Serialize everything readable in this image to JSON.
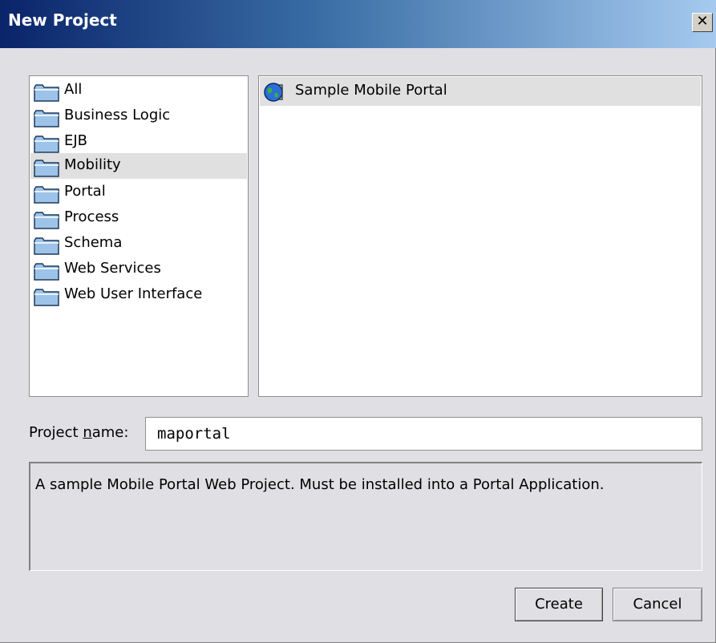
{
  "window": {
    "title": "New Project",
    "close_glyph": "✕"
  },
  "categories": {
    "items": [
      {
        "label": "All",
        "icon": "folder-icon"
      },
      {
        "label": "Business Logic",
        "icon": "folder-icon"
      },
      {
        "label": "EJB",
        "icon": "folder-icon"
      },
      {
        "label": "Mobility",
        "icon": "folder-icon",
        "selected": true
      },
      {
        "label": "Portal",
        "icon": "folder-icon"
      },
      {
        "label": "Process",
        "icon": "folder-icon"
      },
      {
        "label": "Schema",
        "icon": "folder-icon"
      },
      {
        "label": "Web Services",
        "icon": "folder-icon"
      },
      {
        "label": "Web User Interface",
        "icon": "folder-icon"
      }
    ]
  },
  "templates": {
    "items": [
      {
        "label": "Sample Mobile Portal",
        "icon": "globe-icon",
        "selected": true
      }
    ]
  },
  "project_name": {
    "label_prefix": "Project ",
    "label_mnemonic": "n",
    "label_suffix": "ame:",
    "value": "maportal"
  },
  "description": "A sample Mobile Portal Web Project. Must be installed into a Portal Application.",
  "buttons": {
    "create": "Create",
    "cancel": "Cancel"
  },
  "colors": {
    "title_bar_start": "#0a246a",
    "title_bar_end": "#a6caf0",
    "selection": "#e0e0e0",
    "dialog_bg": "#e0dfe3"
  }
}
